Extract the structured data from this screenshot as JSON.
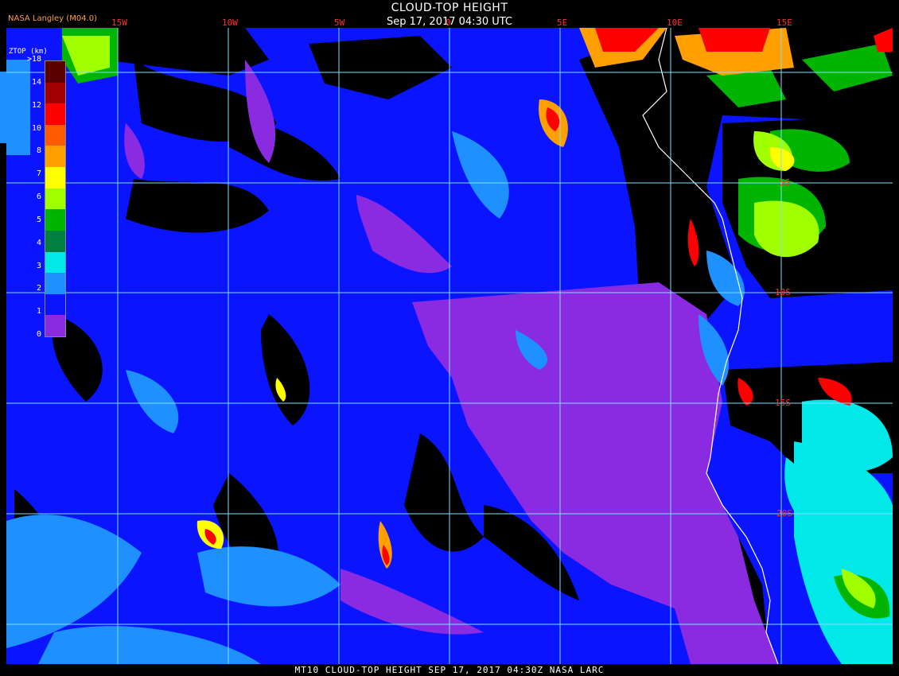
{
  "header": {
    "title": "CLOUD-TOP HEIGHT",
    "subtitle": "Sep 17, 2017 04:30 UTC",
    "provider": "NASA Langley (M04.0)"
  },
  "legend": {
    "title": "ZTOP (km)",
    "labels": [
      ">18",
      "14",
      "12",
      "10",
      "8",
      "7",
      "6",
      "5",
      "4",
      "3",
      "2",
      "1",
      "0"
    ],
    "colors": [
      "#5a0000",
      "#a00000",
      "#ff0000",
      "#ff5a00",
      "#ffa000",
      "#ffff00",
      "#a0ff00",
      "#00b400",
      "#008040",
      "#00e8e8",
      "#1e90ff",
      "#0a14ff",
      "#8a2be2"
    ]
  },
  "map": {
    "longitude_labels": [
      "15W",
      "10W",
      "5W",
      "0",
      "5E",
      "10E",
      "15E"
    ],
    "latitude_labels": [
      "5S",
      "10S",
      "15S",
      "20S"
    ],
    "grid_color": "#7fdfff",
    "coast_color": "#ffffff",
    "ocean_blue": "#0a14ff",
    "violet_stratus": "#8a2be2",
    "clear_sky": "#000000"
  },
  "footer": {
    "text": "MT10  CLOUD-TOP HEIGHT  SEP 17, 2017 04:30Z  NASA LARC"
  }
}
